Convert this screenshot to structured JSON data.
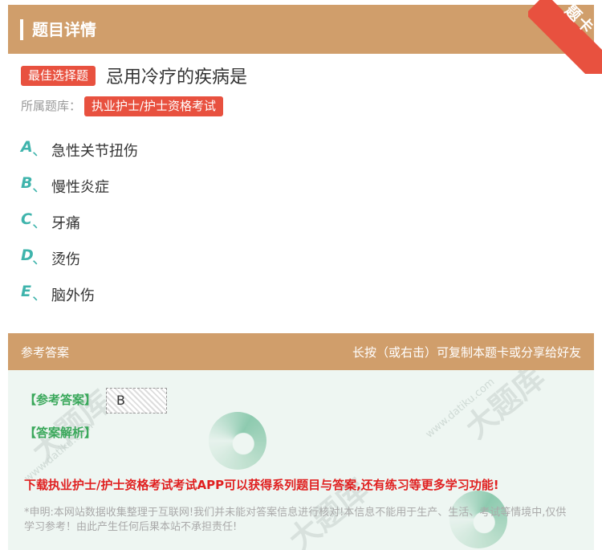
{
  "header": {
    "title": "题目详情",
    "corner_badge": "题卡"
  },
  "question": {
    "type_badge": "最佳选择题",
    "title": "忌用冷疗的疾病是",
    "bank_label": "所属题库：",
    "bank_tag": "执业护士/护士资格考试"
  },
  "options": [
    {
      "letter": "A",
      "sep": "、",
      "text": "急性关节扭伤"
    },
    {
      "letter": "B",
      "sep": "、",
      "text": "慢性炎症"
    },
    {
      "letter": "C",
      "sep": "、",
      "text": "牙痛"
    },
    {
      "letter": "D",
      "sep": "、",
      "text": "烫伤"
    },
    {
      "letter": "E",
      "sep": "、",
      "text": "脑外伤"
    }
  ],
  "answer_bar": {
    "left": "参考答案",
    "right": "长按（或右击）可复制本题卡或分享给好友"
  },
  "answer": {
    "label": "【参考答案】",
    "value": "B",
    "analysis_label": "【答案解析】",
    "promo": "下载执业护士/护士资格考试考试APP可以获得系列题目与答案,还有练习等更多学习功能!",
    "disclaimer": "*申明:本网站数据收集整理于互联网!我们并未能对答案信息进行核对!本信息不能用于生产、生活、考试等情境中,仅供学习参考！由此产生任何后果本站不承担责任!"
  },
  "watermark": {
    "text": "大题库",
    "url": "www.datiku.com"
  },
  "colors": {
    "header_bg": "#d09e6b",
    "accent_red": "#e8513f",
    "option_teal": "#3fb4ac",
    "answer_green": "#3aa85b",
    "promo_red": "#e02020"
  }
}
